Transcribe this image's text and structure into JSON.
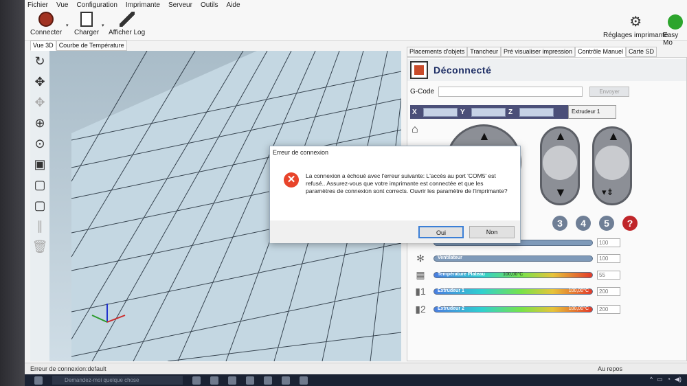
{
  "menu": [
    "Fichier",
    "Vue",
    "Configuration",
    "Imprimante",
    "Serveur",
    "Outils",
    "Aide"
  ],
  "toolbar": {
    "connect": "Connecter",
    "load": "Charger",
    "show_log": "Afficher Log",
    "printer_settings": "Réglages imprimante",
    "easy_mode": "Easy Mo"
  },
  "left_tabs": [
    "Vue 3D",
    "Courbe de Température"
  ],
  "right_tabs": [
    "Placements d'objets",
    "Trancheur",
    "Pré visualiser impression",
    "Contrôle Manuel",
    "Carte SD"
  ],
  "control": {
    "status": "Déconnecté",
    "gcode_label": "G-Code",
    "send": "Envoyer",
    "axes": [
      "X",
      "Y",
      "Z"
    ],
    "extruder_select": "Extrudeur 1",
    "buttons": [
      "3",
      "4",
      "5",
      "?"
    ],
    "rows": [
      {
        "name": "",
        "value": "100"
      },
      {
        "name": "Ventilateur",
        "value": "100"
      },
      {
        "name": "Température Plateau",
        "reading": "100,00°C",
        "value": "55"
      },
      {
        "name": "Extrudeur 1",
        "reading": "100,00°C",
        "value": "200",
        "index": "1"
      },
      {
        "name": "Extrudeur 2",
        "reading": "100,00°C",
        "value": "200",
        "index": "2"
      }
    ]
  },
  "dialog": {
    "title": "Erreur de connexion",
    "message": "La connexion a échoué avec l'erreur suivante: L'accès au port 'COM5' est refusé.. Assurez-vous que votre imprimante est connectée et que les paramètres de connexion sont corrects. Ouvrir les paramètre de l'imprimante?",
    "yes": "Oui",
    "no": "Non"
  },
  "statusbar": {
    "left": "Erreur de connexion:default",
    "right": "Au repos"
  },
  "taskbar": {
    "search_placeholder": "Demandez-moi quelque chose"
  }
}
